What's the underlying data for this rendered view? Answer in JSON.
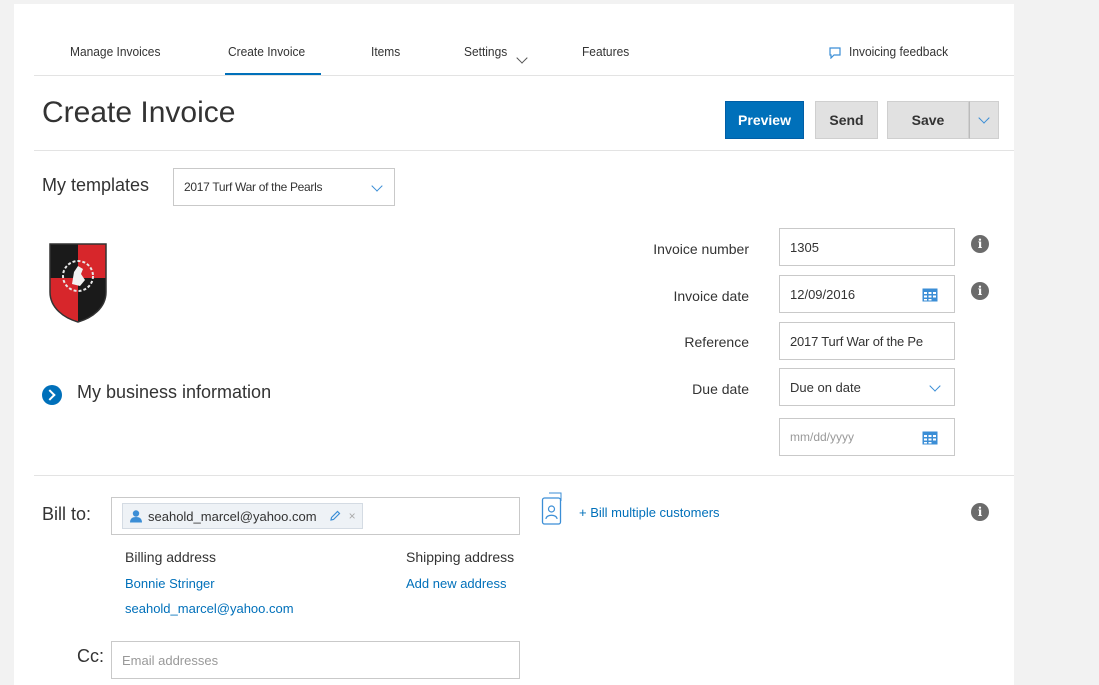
{
  "nav": {
    "items": [
      {
        "label": "Manage Invoices"
      },
      {
        "label": "Create Invoice"
      },
      {
        "label": "Items"
      },
      {
        "label": "Settings"
      },
      {
        "label": "Features"
      }
    ],
    "feedback_label": "Invoicing feedback"
  },
  "header": {
    "title": "Create Invoice",
    "preview_label": "Preview",
    "send_label": "Send",
    "save_label": "Save"
  },
  "templates": {
    "label": "My templates",
    "selected": "2017 Turf War of the Pearls"
  },
  "business": {
    "label": "My business information"
  },
  "invoice_fields": {
    "invoice_number_label": "Invoice number",
    "invoice_number_value": "1305",
    "invoice_date_label": "Invoice date",
    "invoice_date_value": "12/09/2016",
    "reference_label": "Reference",
    "reference_value": "2017 Turf War of the Pe",
    "due_date_label": "Due date",
    "due_date_selected": "Due on date",
    "due_date_placeholder": "mm/dd/yyyy"
  },
  "bill_to": {
    "label": "Bill to:",
    "recipient_chip": "seahold_marcel@yahoo.com",
    "bill_multiple_label": "+ Bill multiple customers",
    "billing_address_label": "Billing address",
    "billing_name": "Bonnie Stringer",
    "billing_email": "seahold_marcel@yahoo.com",
    "shipping_address_label": "Shipping address",
    "add_new_address": "Add new address"
  },
  "cc": {
    "label": "Cc:",
    "placeholder": "Email addresses"
  },
  "colors": {
    "accent": "#0070ba",
    "logo_red": "#d7262b",
    "logo_black": "#1a1a1a"
  }
}
